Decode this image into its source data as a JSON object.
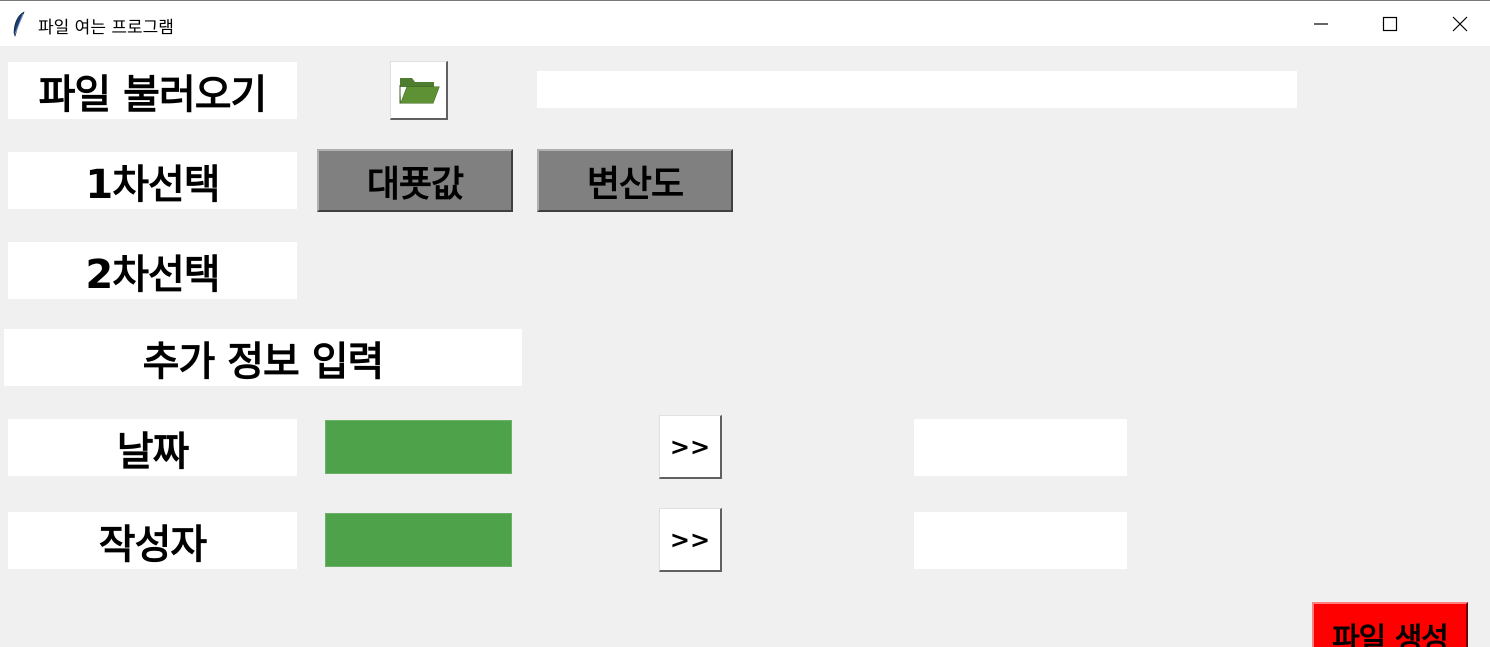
{
  "window": {
    "title": "파일 여는 프로그램",
    "icon": "feather-icon"
  },
  "file_load": {
    "label": "파일 불러오기",
    "folder_button_icon": "open-folder-icon",
    "path_value": ""
  },
  "first_choice": {
    "label": "1차선택",
    "buttons": [
      "대푯값",
      "변산도"
    ]
  },
  "second_choice": {
    "label": "2차선택"
  },
  "extra_info": {
    "label": "추가 정보 입력"
  },
  "date_row": {
    "label": "날짜",
    "input_value": "",
    "arrow_label": ">>",
    "output_value": ""
  },
  "author_row": {
    "label": "작성자",
    "input_value": "",
    "arrow_label": ">>",
    "output_value": ""
  },
  "generate_button": {
    "label": "파일 생성"
  },
  "colors": {
    "green_field": "#4ea24a",
    "gray_button": "#808080",
    "generate_red": "#ff0000",
    "folder_icon": "#4e7d2f"
  }
}
